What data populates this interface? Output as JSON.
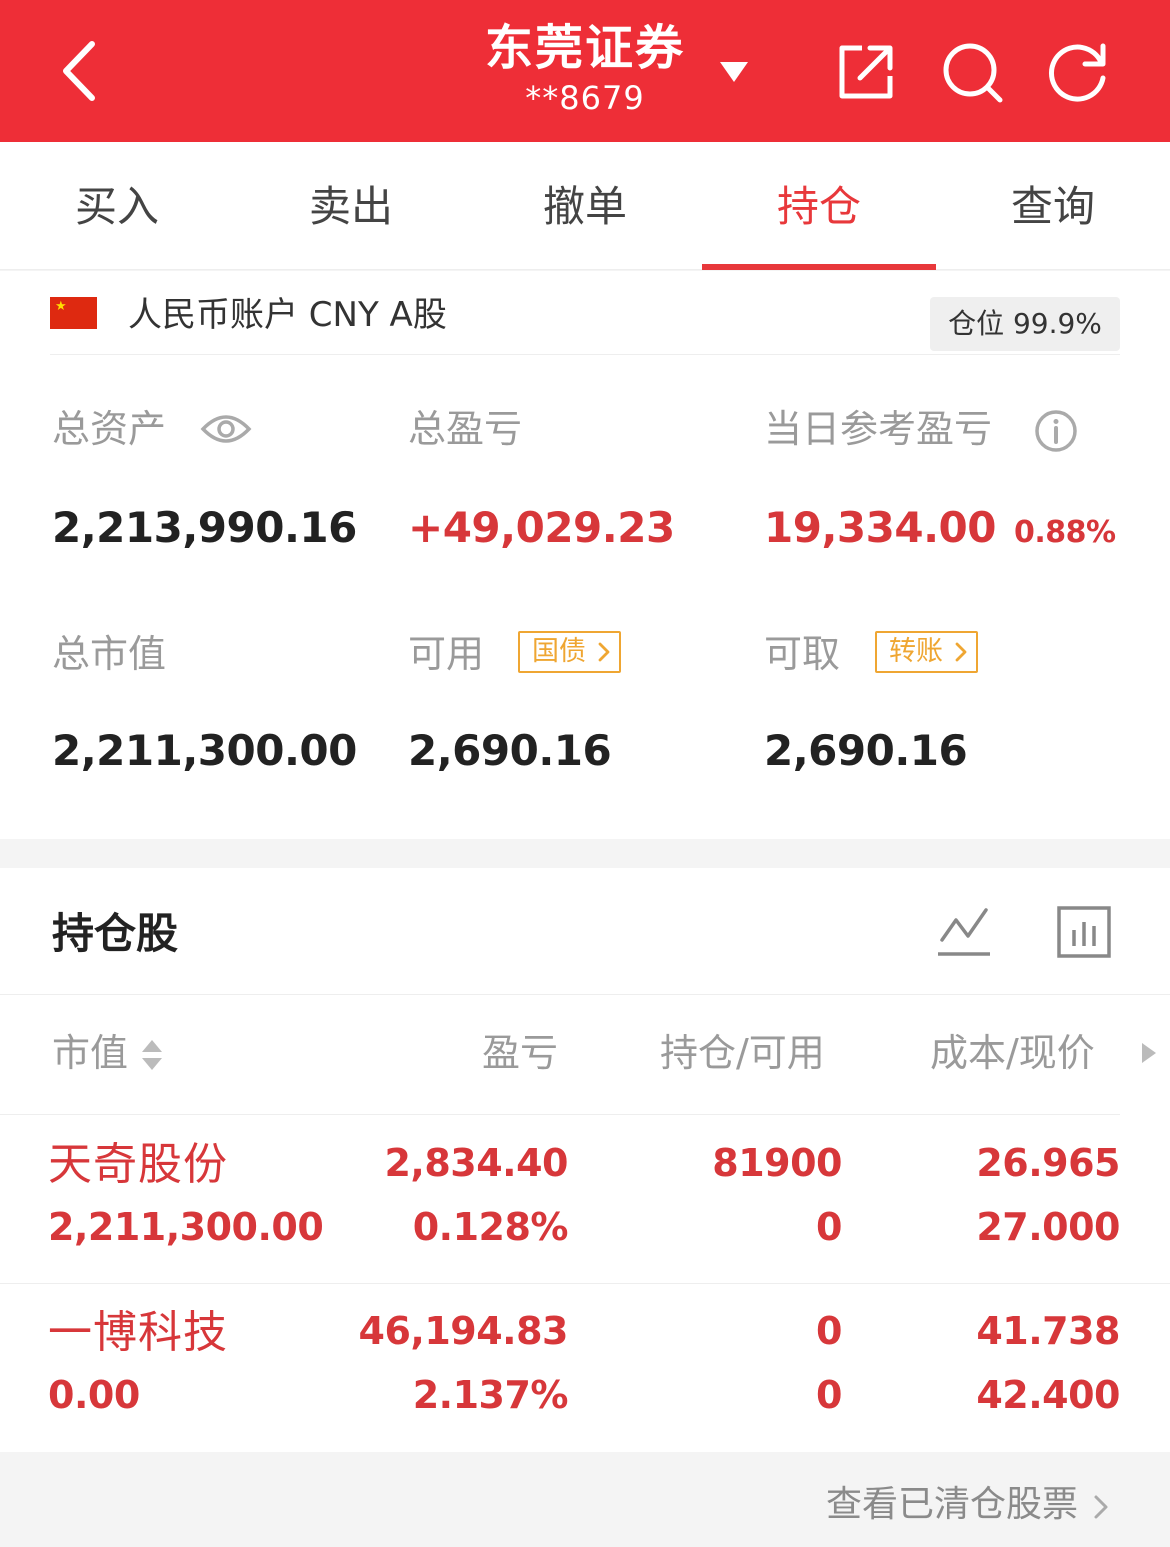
{
  "header": {
    "title": "东莞证券",
    "account_masked": "**8679",
    "bg_color": "#ee2e37"
  },
  "tabs": [
    {
      "label": "买入",
      "active": false
    },
    {
      "label": "卖出",
      "active": false
    },
    {
      "label": "撤单",
      "active": false
    },
    {
      "label": "持仓",
      "active": true
    },
    {
      "label": "查询",
      "active": false
    }
  ],
  "account": {
    "label": "人民币账户 CNY A股",
    "position_label": "仓位 99.9%",
    "flag_icon": "cn-flag-icon"
  },
  "summary": {
    "total_assets_label": "总资产",
    "total_assets": "2,213,990.16",
    "total_pl_label": "总盈亏",
    "total_pl": "+49,029.23",
    "daily_pl_label": "当日参考盈亏",
    "daily_pl": "19,334.00",
    "daily_pl_pct": "0.88%",
    "market_value_label": "总市值",
    "market_value": "2,211,300.00",
    "available_label": "可用",
    "available_tag": "国债",
    "available": "2,690.16",
    "withdrawable_label": "可取",
    "withdrawable_tag": "转账",
    "withdrawable": "2,690.16"
  },
  "holdings": {
    "title": "持仓股",
    "columns": [
      "市值",
      "盈亏",
      "持仓/可用",
      "成本/现价"
    ],
    "rows": [
      {
        "name": "天奇股份",
        "market_value": "2,211,300.00",
        "pl": "2,834.40",
        "pl_pct": "0.128%",
        "position": "81900",
        "available": "0",
        "cost": "26.965",
        "price": "27.000"
      },
      {
        "name": "一博科技",
        "market_value": "0.00",
        "pl": "46,194.83",
        "pl_pct": "2.137%",
        "position": "0",
        "available": "0",
        "cost": "41.738",
        "price": "42.400"
      }
    ]
  },
  "footer": {
    "closed_link": "查看已清仓股票"
  }
}
